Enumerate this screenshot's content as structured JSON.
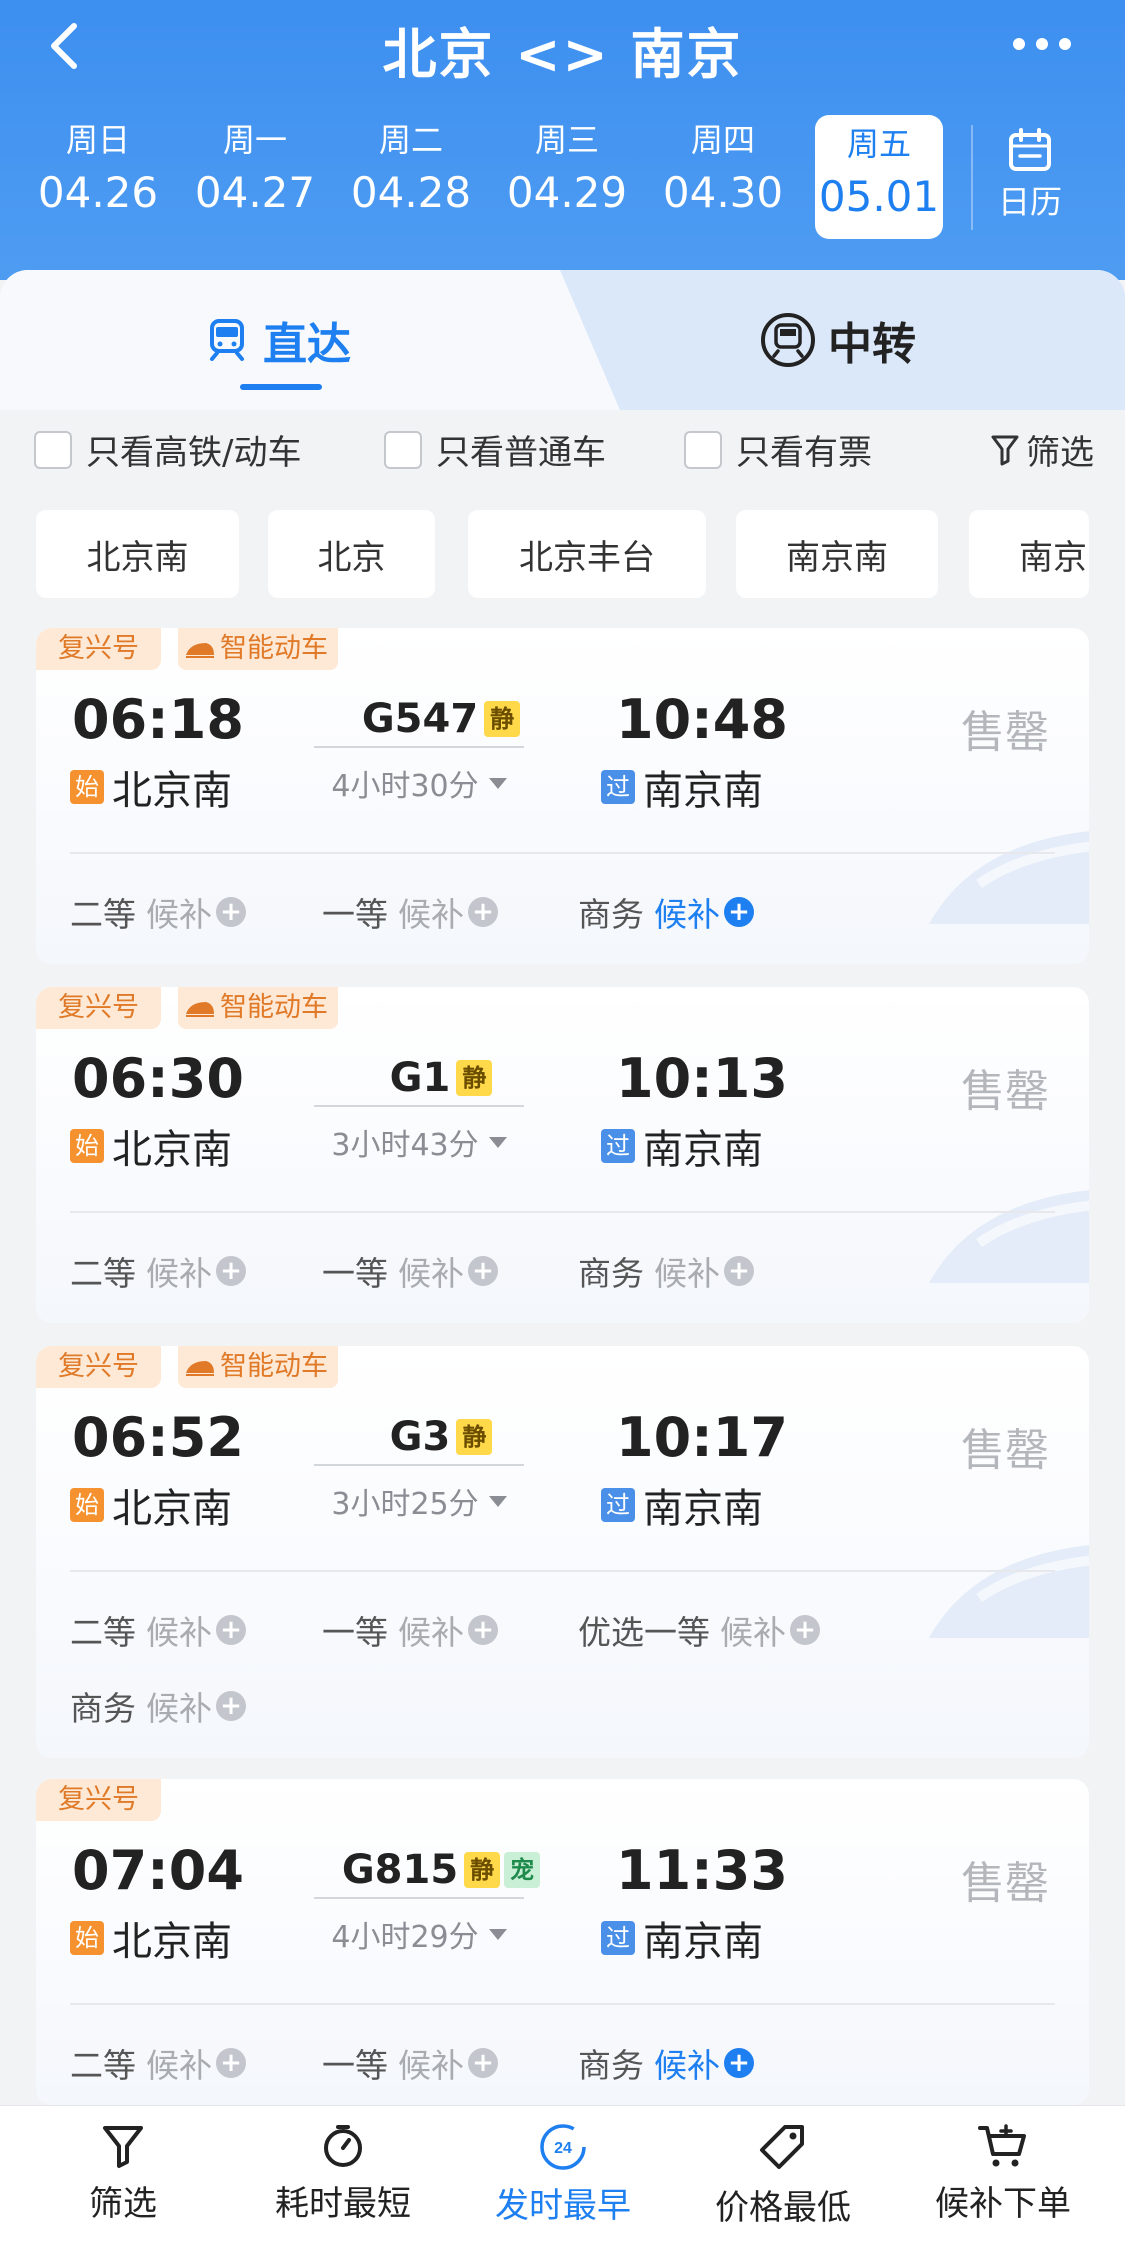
{
  "header": {
    "title": "北京 <> 南京",
    "dates": [
      {
        "weekday": "周日",
        "date": "04.26"
      },
      {
        "weekday": "周一",
        "date": "04.27"
      },
      {
        "weekday": "周二",
        "date": "04.28"
      },
      {
        "weekday": "周三",
        "date": "04.29"
      },
      {
        "weekday": "周四",
        "date": "04.30"
      },
      {
        "weekday": "周五",
        "date": "05.01",
        "selected": true
      }
    ],
    "calendar_label": "日历"
  },
  "tabs": {
    "direct": "直达",
    "transfer": "中转"
  },
  "filters": {
    "high_speed": "只看高铁/动车",
    "normal": "只看普通车",
    "available": "只看有票",
    "filter_label": "筛选"
  },
  "stations": [
    "北京南",
    "北京",
    "北京丰台",
    "南京南",
    "南京"
  ],
  "trains": [
    {
      "tag_brand": "复兴号",
      "tag_smart": "智能动车",
      "dep_time": "06:18",
      "dep_station_badge": "始",
      "dep_station": "北京南",
      "train_no": "G547",
      "quiet_badge": "静",
      "duration": "4小时30分",
      "arr_time": "10:48",
      "arr_station_badge": "过",
      "arr_station": "南京南",
      "status": "售罄",
      "seats": [
        {
          "class": "二等",
          "state": "候补"
        },
        {
          "class": "一等",
          "state": "候补"
        },
        {
          "class": "商务",
          "state": "候补"
        }
      ]
    },
    {
      "tag_brand": "复兴号",
      "tag_smart": "智能动车",
      "dep_time": "06:30",
      "dep_station_badge": "始",
      "dep_station": "北京南",
      "train_no": "G1",
      "quiet_badge": "静",
      "duration": "3小时43分",
      "arr_time": "10:13",
      "arr_station_badge": "过",
      "arr_station": "南京南",
      "status": "售罄",
      "seats": [
        {
          "class": "二等",
          "state": "候补"
        },
        {
          "class": "一等",
          "state": "候补"
        },
        {
          "class": "商务",
          "state": "候补"
        }
      ]
    },
    {
      "tag_brand": "复兴号",
      "tag_smart": "智能动车",
      "dep_time": "06:52",
      "dep_station_badge": "始",
      "dep_station": "北京南",
      "train_no": "G3",
      "quiet_badge": "静",
      "duration": "3小时25分",
      "arr_time": "10:17",
      "arr_station_badge": "过",
      "arr_station": "南京南",
      "status": "售罄",
      "seats": [
        {
          "class": "二等",
          "state": "候补"
        },
        {
          "class": "一等",
          "state": "候补"
        },
        {
          "class": "优选一等",
          "state": "候补"
        },
        {
          "class": "商务",
          "state": "候补"
        }
      ]
    },
    {
      "tag_brand": "复兴号",
      "dep_time": "07:04",
      "dep_station_badge": "始",
      "dep_station": "北京南",
      "train_no": "G815",
      "quiet_badge": "静",
      "pet_badge": "宠",
      "duration": "4小时29分",
      "arr_time": "11:33",
      "arr_station_badge": "过",
      "arr_station": "南京南",
      "status": "售罄",
      "seats": [
        {
          "class": "二等",
          "state": "候补"
        },
        {
          "class": "一等",
          "state": "候补"
        },
        {
          "class": "商务",
          "state": "候补"
        }
      ]
    }
  ],
  "bottom_bar": [
    {
      "label": "筛选",
      "icon": "funnel-icon"
    },
    {
      "label": "耗时最短",
      "icon": "stopwatch-icon"
    },
    {
      "label": "发时最早",
      "icon": "clock-24-icon",
      "active": true,
      "icon_text": "24"
    },
    {
      "label": "价格最低",
      "icon": "price-tag-icon"
    },
    {
      "label": "候补下单",
      "icon": "cart-plus-icon"
    }
  ],
  "colors": {
    "header": "#3d8ff0",
    "accent": "#1e7ff0",
    "tag_bg": "#fde9d6",
    "tag_text": "#e07a28"
  }
}
